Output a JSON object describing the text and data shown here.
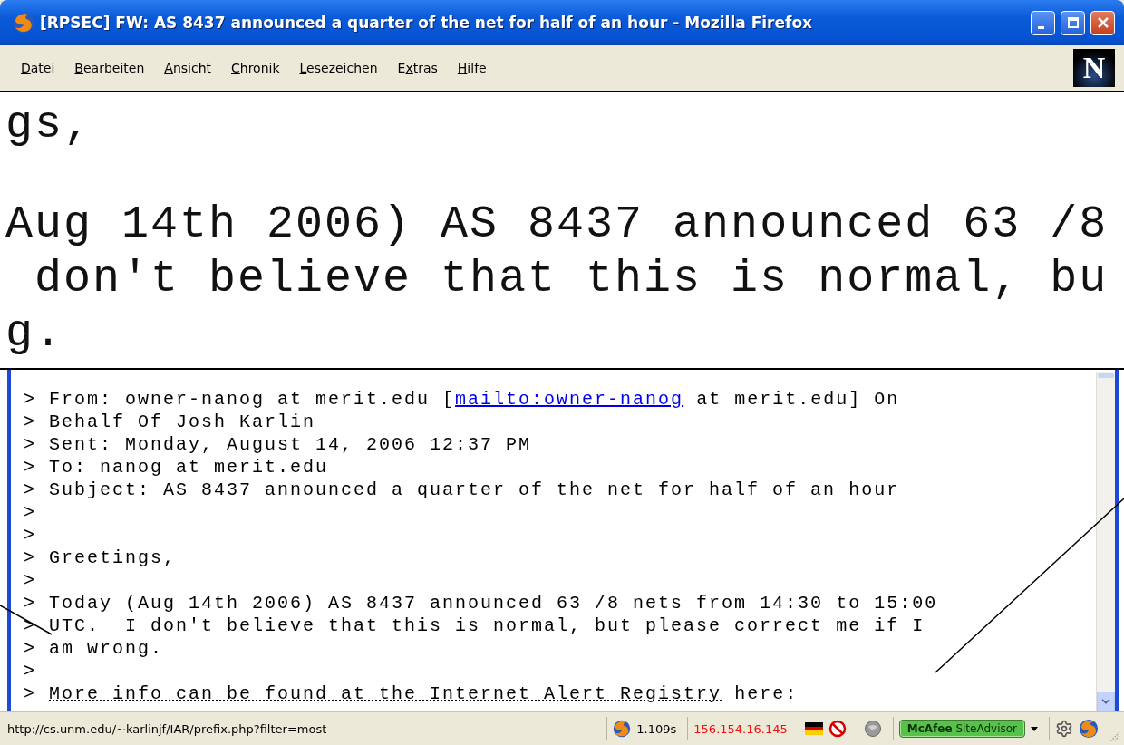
{
  "window": {
    "title": "[RPSEC] FW: AS 8437 announced a quarter of the net for half of an hour - Mozilla Firefox"
  },
  "menu": [
    {
      "key": "D",
      "after": "atei"
    },
    {
      "key": "B",
      "after": "earbeiten"
    },
    {
      "key": "A",
      "after": "nsicht"
    },
    {
      "key": "C",
      "after": "hronik"
    },
    {
      "key": "L",
      "after": "esezeichen"
    },
    {
      "before": "E",
      "key": "x",
      "after": "tras"
    },
    {
      "key": "H",
      "after": "ilfe"
    }
  ],
  "throbber": "N",
  "magnifier": {
    "paragraphs": [
      {
        "lines": [
          {
            "text": "gs,",
            "indented": false
          }
        ]
      },
      {
        "lines": [
          {
            "text": "Aug 14th 2006) AS 8437 announced 63 /8",
            "indented": false
          },
          {
            "text": "don't believe that this is normal, bu",
            "indented": true
          },
          {
            "text": "g.",
            "indented": false
          }
        ]
      }
    ]
  },
  "message": {
    "lines": [
      {
        "kind": "mail_link",
        "text": "> From: owner-nanog at merit.edu [",
        "link": "mailto:owner-nanog",
        "after": " at merit.edu] On"
      },
      {
        "kind": "plain",
        "text": "> Behalf Of Josh Karlin"
      },
      {
        "kind": "plain",
        "text": "> Sent: Monday, August 14, 2006 12:37 PM"
      },
      {
        "kind": "plain",
        "text": "> To: nanog at merit.edu"
      },
      {
        "kind": "plain",
        "text": "> Subject: AS 8437 announced a quarter of the net for half of an hour"
      },
      {
        "kind": "plain",
        "text": ">"
      },
      {
        "kind": "plain",
        "text": ">"
      },
      {
        "kind": "plain",
        "text": "> Greetings,"
      },
      {
        "kind": "plain",
        "text": ">"
      },
      {
        "kind": "plain",
        "text": "> Today (Aug 14th 2006) AS 8437 announced 63 /8 nets from 14:30 to 15:00"
      },
      {
        "kind": "plain",
        "text": "> UTC.  I don't believe that this is normal, but please correct me if I"
      },
      {
        "kind": "plain",
        "text": "> am wrong."
      },
      {
        "kind": "plain",
        "text": ">"
      },
      {
        "kind": "hover_link",
        "text": "> ",
        "link": "More info can be found at the Internet Alert Registry",
        "after": " here:"
      }
    ]
  },
  "status_bar": {
    "url": "http://cs.unm.edu/~karlinjf/IAR/prefix.php?filter=most",
    "load_time": "1.109s",
    "ip": "156.154.16.145",
    "siteadvisor": "**McAfee** SiteAdvisor"
  }
}
